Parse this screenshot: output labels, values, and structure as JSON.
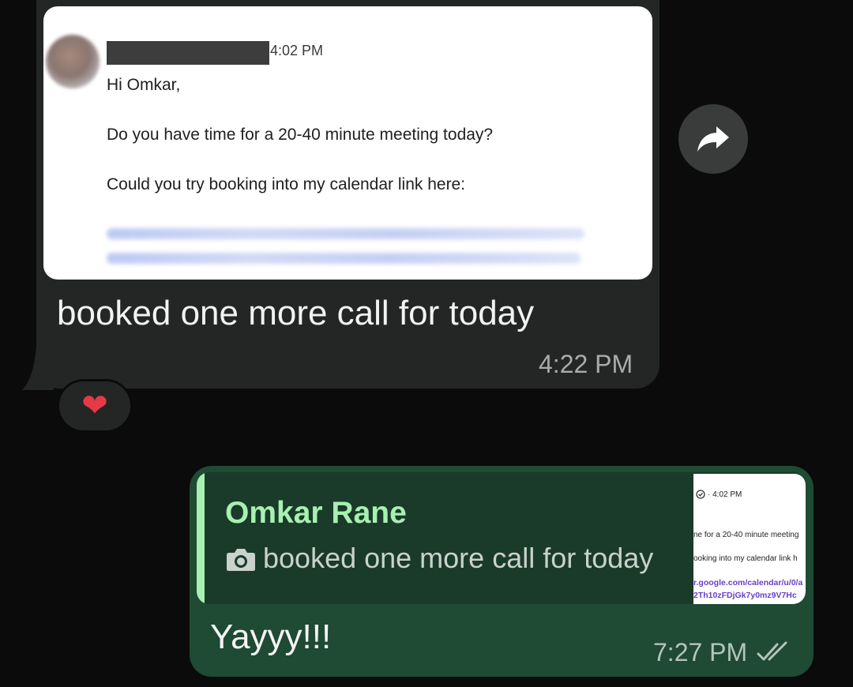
{
  "incoming": {
    "screenshot": {
      "time": "4:02 PM",
      "greeting": "Hi Omkar,",
      "line1": "Do you have time for a 20-40 minute meeting today?",
      "line2": "Could you try booking into my calendar link here:"
    },
    "text": "booked one more call for today",
    "time": "4:22 PM",
    "reaction": "❤"
  },
  "outgoing": {
    "quote": {
      "sender": "Omkar Rane",
      "text": "booked one more call for today",
      "thumb": {
        "time": "4:02 PM",
        "line1": "ne for a 20-40 minute meeting",
        "line2": "ooking into my calendar link h",
        "link1": "r.google.com/calendar/u/0/a",
        "link2": "2Th10zFDjGk7y0mz9V7Hc"
      }
    },
    "text": "Yayyy!!!",
    "time": "7:27 PM"
  },
  "colors": {
    "incoming_bubble": "#242626",
    "outgoing_bubble": "#1f4a34",
    "quote_accent": "#a8f0b1"
  }
}
